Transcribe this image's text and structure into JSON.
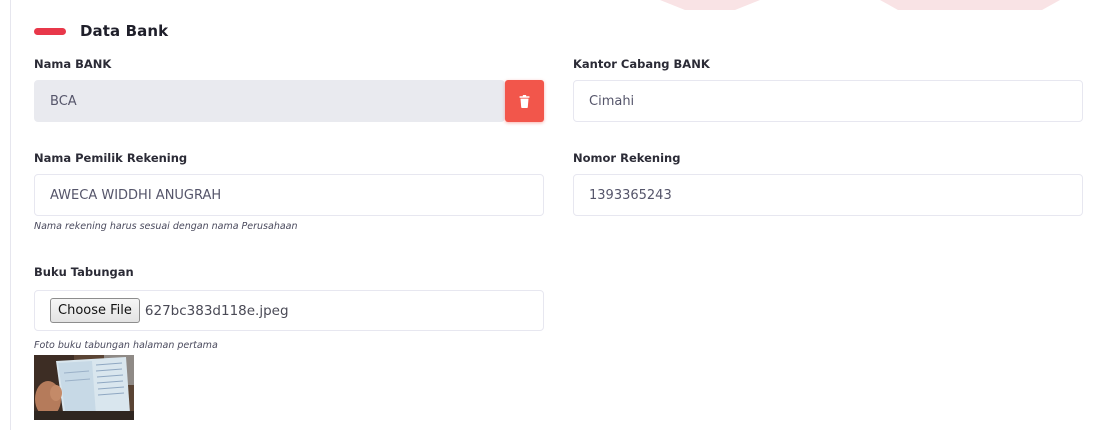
{
  "section": {
    "title": "Data Bank"
  },
  "fields": {
    "bank_name": {
      "label": "Nama BANK",
      "value": "BCA"
    },
    "branch": {
      "label": "Kantor Cabang BANK",
      "value": "Cimahi"
    },
    "account_holder": {
      "label": "Nama Pemilik Rekening",
      "value": "AWECA WIDDHI ANUGRAH",
      "hint": "Nama rekening harus sesuai dengan nama Perusahaan"
    },
    "account_number": {
      "label": "Nomor Rekening",
      "value": "1393365243"
    },
    "passbook": {
      "label": "Buku Tabungan",
      "button_label": "Choose File",
      "file_name": "627bc383d118e.jpeg",
      "hint": "Foto buku tabungan halaman pertama"
    }
  },
  "icons": {
    "delete": "trash-icon"
  },
  "colors": {
    "accent": "#e8384a",
    "delete_button": "#f2564b",
    "disabled_field": "#e9eaef"
  }
}
